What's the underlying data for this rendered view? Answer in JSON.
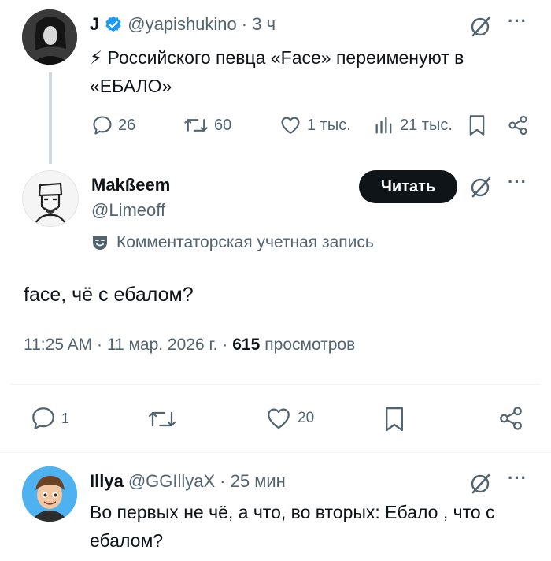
{
  "tweet1": {
    "name": "J",
    "handle": "@yapishukino",
    "time": "· 3 ч",
    "body": "⚡ Российского певца «Face» переименуют в «ЕБАЛО»",
    "replies": "26",
    "retweets": "60",
    "likes": "1 тыс.",
    "views": "21 тыс."
  },
  "tweet2": {
    "name": "Makßeem",
    "handle": "@Limeoff",
    "follow": "Читать",
    "community_note": "Комментаторская учетная запись",
    "body": "face, чё с ебалом?",
    "timestamp": "11:25 AM · 11 мар. 2026 г. ·",
    "views_count": "615",
    "views_label": "просмотров",
    "replies": "1",
    "likes": "20"
  },
  "tweet3": {
    "name": "Illya",
    "handle": "@GGIllyaX",
    "time": "· 25 мин",
    "body": "Во первых не чё, а что, во вторых: Ебало , что с ебалом?"
  },
  "colors": {
    "verified": "#1d9bf0",
    "muted": "#536471",
    "text": "#0f1419",
    "follow_bg": "#0f1419"
  }
}
